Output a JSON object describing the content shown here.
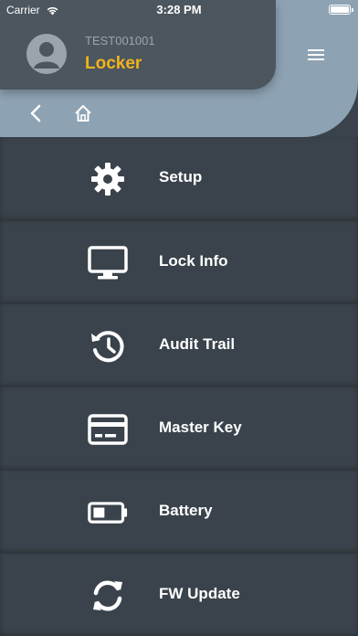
{
  "status_bar": {
    "carrier": "Carrier",
    "time": "3:28 PM"
  },
  "header": {
    "device_id": "TEST001001",
    "title": "Locker",
    "title_color": "#f2b31d"
  },
  "menu": [
    {
      "label": "Setup",
      "icon": "gear-icon"
    },
    {
      "label": "Lock Info",
      "icon": "monitor-icon"
    },
    {
      "label": "Audit Trail",
      "icon": "history-icon"
    },
    {
      "label": "Master Key",
      "icon": "card-icon"
    },
    {
      "label": "Battery",
      "icon": "battery-icon"
    },
    {
      "label": "FW Update",
      "icon": "sync-icon"
    }
  ]
}
